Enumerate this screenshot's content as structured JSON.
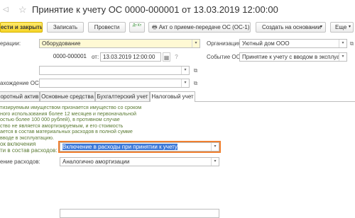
{
  "window": {
    "title": "Принятие к учету ОС 0000-000001 от 13.03.2019 12:00:00"
  },
  "toolbar": {
    "post_close": "ести и закрыть",
    "save": "Записать",
    "post": "Провести",
    "doc_icon_label": "Дт Кт",
    "print": "Акт о приеме-передаче ОС (ОС-1)",
    "create_based": "Создать на основании",
    "more": "Еще"
  },
  "form": {
    "operation_label": "ерации:",
    "operation_value": "Оборудование",
    "number_value": "0000-000001",
    "date_label": "от:",
    "date_value": "13.03.2019 12:00:00",
    "location_label": "ахождение ОС:",
    "organization_label": "Организация:",
    "organization_value": "Уютный дом ООО",
    "event_label": "Событие ОС:",
    "event_value": "Принятие к учету с вводом в эксплуатацию"
  },
  "tabs": [
    {
      "label": "оротный актив"
    },
    {
      "label": "Основные средства"
    },
    {
      "label": "Бухгалтерский учет"
    },
    {
      "label": "Налоговый учет"
    }
  ],
  "tax": {
    "info_lines": [
      "тизируемым имуществом признается имущество со сроком",
      "ного использования более 12 месяцев и первоначальной",
      "остью более 100 000 рублей), в противном случае",
      "ство не является амортизируемым, и его стоимость",
      "ается в состав материальных расходов в полной сумме",
      "вводе в эксплуатацию."
    ],
    "order_label_1": "ок включения",
    "order_label_2": "ти в состав расходов:",
    "order_value": "Включение в расходы при принятии к учету",
    "expense_label": "ение расходов:",
    "expense_value": "Аналогично амортизации"
  }
}
